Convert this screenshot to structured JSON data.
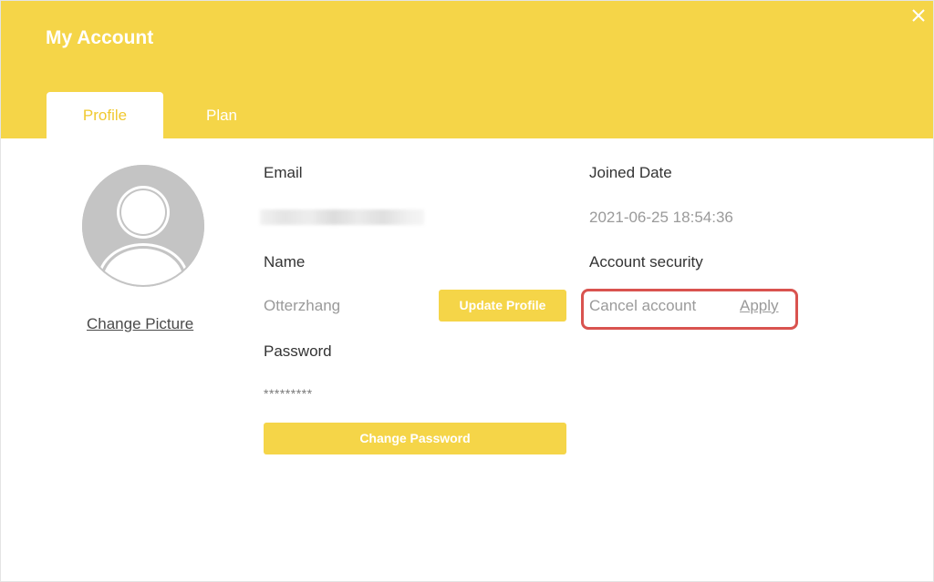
{
  "window": {
    "title": "My Account",
    "close_icon": "close-icon"
  },
  "tabs": [
    {
      "label": "Profile",
      "active": true
    },
    {
      "label": "Plan",
      "active": false
    }
  ],
  "profile": {
    "avatar_icon": "user-avatar-icon",
    "change_picture": "Change Picture",
    "email_label": "Email",
    "email_value_obscured": true,
    "name_label": "Name",
    "name_value": "Otterzhang",
    "update_profile_button": "Update Profile",
    "password_label": "Password",
    "password_value": "*********",
    "change_password_button": "Change Password",
    "joined_date_label": "Joined Date",
    "joined_date_value": "2021-06-25 18:54:36",
    "account_security_label": "Account security",
    "cancel_account_label": "Cancel account",
    "apply_link": "Apply"
  },
  "colors": {
    "accent": "#f5d548",
    "tab_active_text": "#f0c930",
    "highlight": "#d9534f"
  }
}
